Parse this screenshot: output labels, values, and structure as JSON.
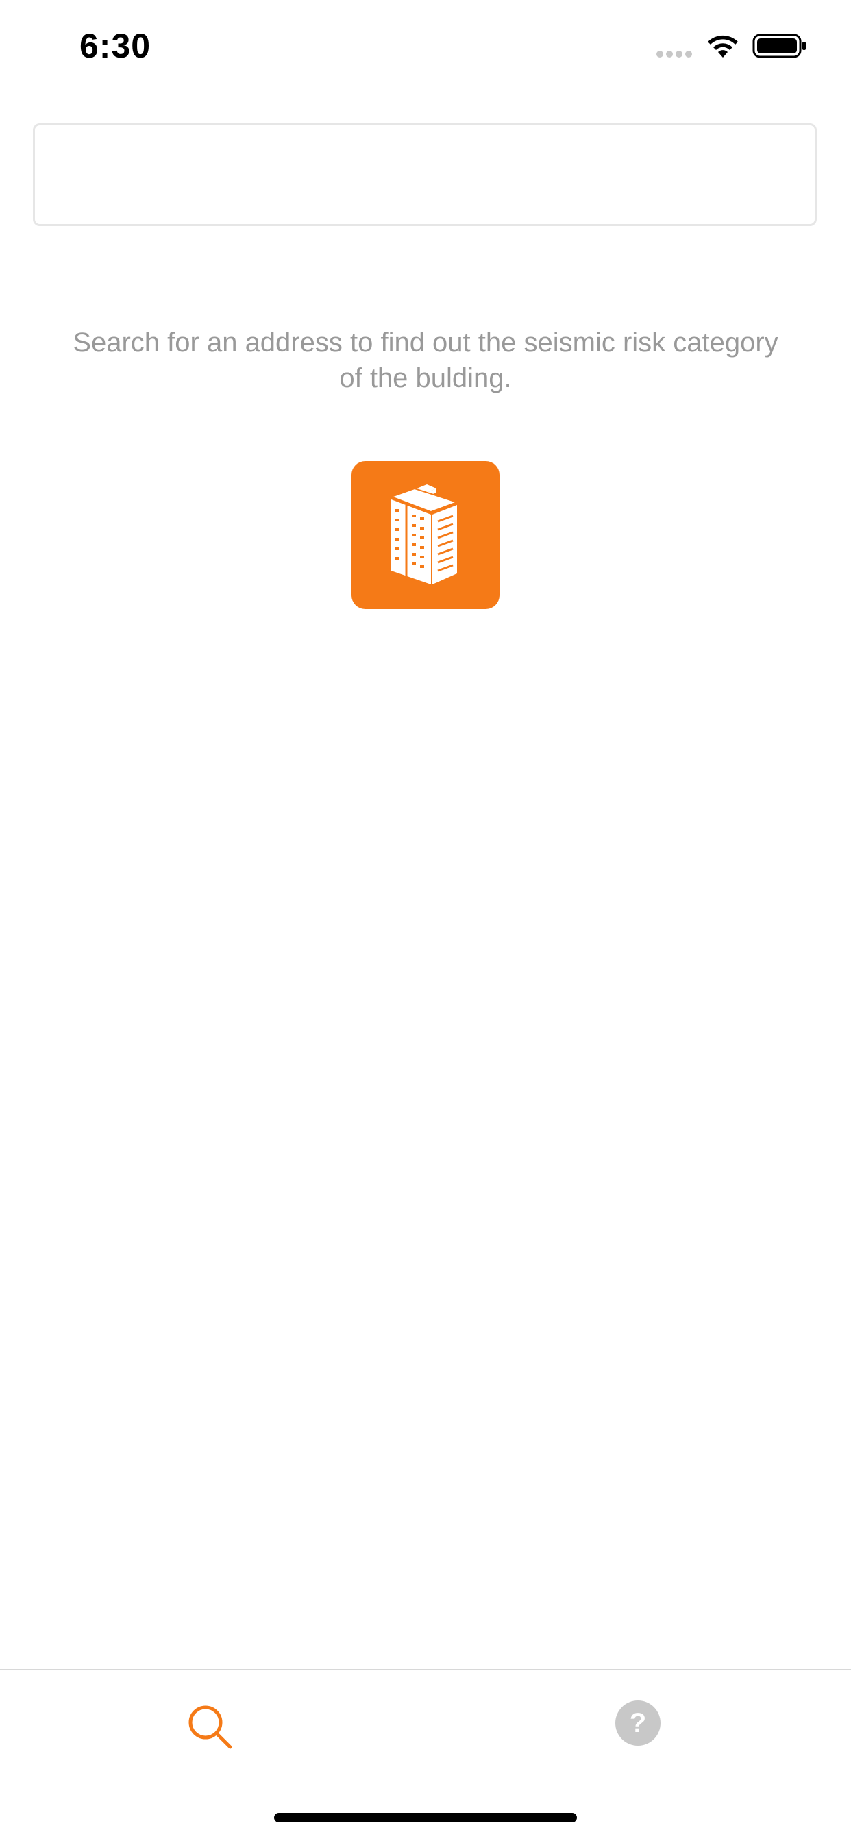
{
  "status_bar": {
    "time": "6:30"
  },
  "search": {
    "value": "",
    "placeholder": ""
  },
  "helper_text": "Search for an address to find out the seismic risk category of the bulding.",
  "tab_bar": {
    "help_glyph": "?",
    "active_tab": "search",
    "tabs": [
      {
        "icon": "search-icon",
        "active": true
      },
      {
        "icon": "help-icon",
        "active": false
      }
    ]
  },
  "colors": {
    "accent": "#f57a17",
    "muted_text": "#999999",
    "inactive_icon": "#c8c8c8"
  }
}
